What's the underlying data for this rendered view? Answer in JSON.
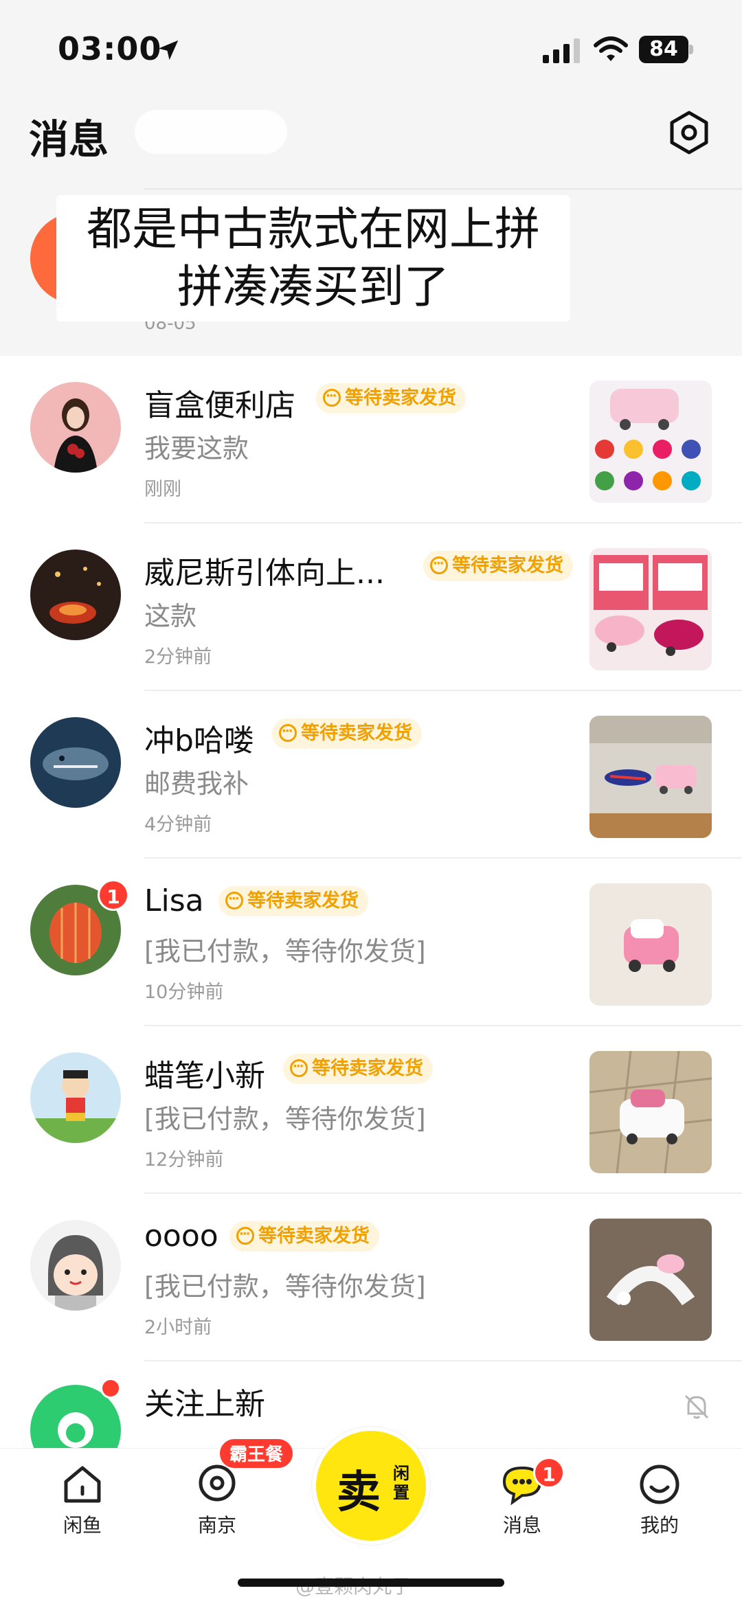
{
  "status_bar": {
    "time": "03:00",
    "battery": "84"
  },
  "header": {
    "title": "消息"
  },
  "top_card": {
    "caption_line1": "都是中古款式在网上拼",
    "caption_line2": "拼凑凑买到了",
    "date": "08-05"
  },
  "conversations": [
    {
      "name": "盲盒便利店",
      "tag": "等待卖家发货",
      "preview": "我要这款",
      "time": "刚刚"
    },
    {
      "name": "威尼斯引体向上...",
      "tag": "等待卖家发货",
      "preview": "这款",
      "time": "2分钟前"
    },
    {
      "name": "冲b哈喽",
      "tag": "等待卖家发货",
      "preview": "邮费我补",
      "time": "4分钟前"
    },
    {
      "name": "Lisa",
      "tag": "等待卖家发货",
      "preview": "[我已付款，等待你发货]",
      "time": "10分钟前",
      "badge": "1"
    },
    {
      "name": "蜡笔小新",
      "tag": "等待卖家发货",
      "preview": "[我已付款，等待你发货]",
      "time": "12分钟前"
    },
    {
      "name": "oooo",
      "tag": "等待卖家发货",
      "preview": "[我已付款，等待你发货]",
      "time": "2小时前"
    }
  ],
  "follow_row": {
    "name": "关注上新"
  },
  "bottom_nav": {
    "items": [
      {
        "label": "闲鱼"
      },
      {
        "label": "南京",
        "pill": "霸王餐"
      },
      {
        "label": "卖",
        "sub": "闲置"
      },
      {
        "label": "消息",
        "badge": "1"
      },
      {
        "label": "我的"
      }
    ]
  },
  "watermark": "@壹颗肉丸子",
  "colors": {
    "accent_yellow": "#ffe60f",
    "tag_orange": "#f0a100",
    "badge_red": "#ff3b30"
  }
}
